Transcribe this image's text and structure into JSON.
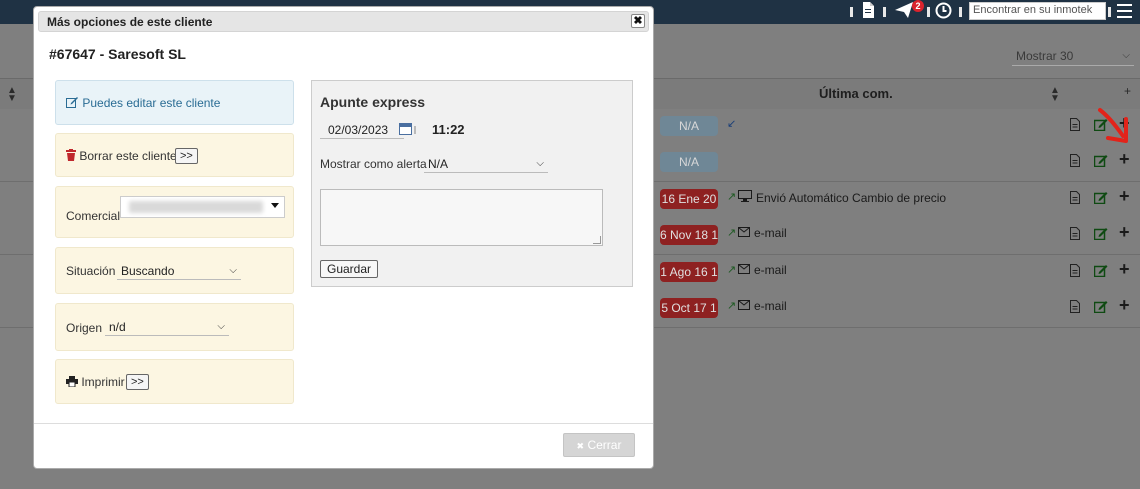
{
  "topbar": {
    "notification_count": "2",
    "search_value": "Encontrar en su inmotek"
  },
  "background": {
    "show_select": "Mostrar 30",
    "column_header": "Última com.",
    "rows": [
      {
        "badge": "N/A",
        "badge_type": "na",
        "arrow": "↙",
        "message": ""
      },
      {
        "badge": "N/A",
        "badge_type": "na",
        "arrow": "",
        "message": ""
      },
      {
        "badge": "16 Ene 20",
        "badge_type": "red",
        "arrow": "↗",
        "message": "Envió Automático Cambio de precio",
        "msg_icon": "monitor-icon"
      },
      {
        "badge": "6 Nov 18 1",
        "badge_type": "red",
        "arrow": "↗",
        "message": "e-mail",
        "msg_icon": "envelope-icon"
      },
      {
        "badge": "1 Ago 16 1",
        "badge_type": "red",
        "arrow": "↗",
        "message": "e-mail",
        "msg_icon": "envelope-icon"
      },
      {
        "badge": "5 Oct 17 1",
        "badge_type": "red",
        "arrow": "↗",
        "message": "e-mail",
        "msg_icon": "envelope-icon"
      }
    ]
  },
  "modal": {
    "title": "Más opciones de este cliente",
    "client": "#67647 - Saresoft SL",
    "edit_link": "Puedes editar este cliente",
    "delete_label": "Borrar este cliente",
    "more_btn": ">>",
    "comercial_label": "Comercial",
    "situacion_label": "Situación",
    "situacion_value": "Buscando",
    "origen_label": "Origen",
    "origen_value": "n/d",
    "print_label": "Imprimir",
    "close_label": "Cerrar"
  },
  "apunte": {
    "title": "Apunte express",
    "date": "02/03/2023",
    "time": "11:22",
    "alert_label": "Mostrar como alerta",
    "alert_value": "N/A",
    "save_label": "Guardar"
  },
  "colors": {
    "topbar": "#1f3244",
    "badge_red": "#8e2121",
    "badge_na": "#6f8796",
    "panel_blue": "#e9f3f8",
    "panel_yellow": "#fcf6e2",
    "arrow_red": "#e2231a"
  }
}
